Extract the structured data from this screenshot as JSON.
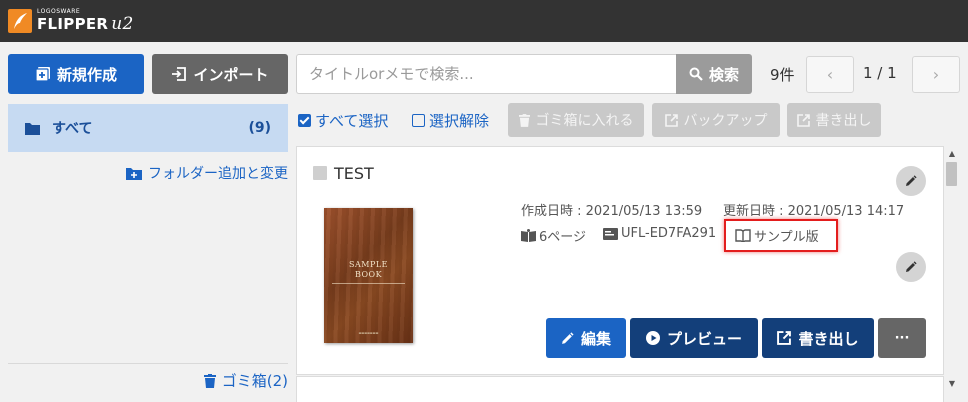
{
  "app": {
    "logo_small": "LOGOSWARE",
    "logo_name": "FLIPPER",
    "logo_suffix": "u2"
  },
  "toolbar": {
    "new_label": "新規作成",
    "import_label": "インポート",
    "search_placeholder": "タイトルorメモで検索...",
    "search_label": "検索",
    "count": "9件",
    "pager_prev": "‹",
    "pager_text": "1 / 1",
    "pager_next": "›"
  },
  "sidebar": {
    "all_label": "すべて",
    "all_count": "(9)",
    "folder_add_label": "フォルダー追加と変更",
    "trash_label": "ゴミ箱(2)"
  },
  "selection": {
    "select_all": "すべて選択",
    "deselect": "選択解除",
    "trash_btn": "ゴミ箱に入れる",
    "backup_btn": "バックアップ",
    "export_btn": "書き出し"
  },
  "book": {
    "title": "TEST",
    "created": "作成日時 : 2021/05/13 13:59",
    "updated": "更新日時 : 2021/05/13 14:17",
    "pages": "6ページ",
    "code": "UFL-ED7FA291",
    "edition": "サンプル版",
    "cover_line1": "SAMPLE",
    "cover_line2": "BOOK",
    "edit_btn": "編集",
    "preview_btn": "プレビュー",
    "export_btn": "書き出し",
    "more_btn": "···"
  },
  "colors": {
    "primary": "#1b64c4",
    "dark_navy": "#133f7a",
    "highlight": "#e31d1d",
    "topbar": "#333333"
  }
}
